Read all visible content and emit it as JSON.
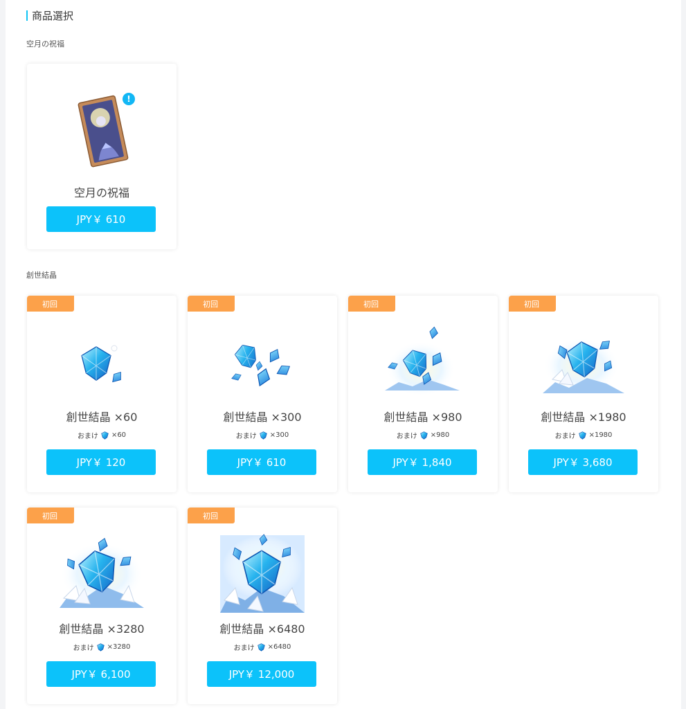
{
  "header": {
    "title": "商品選択"
  },
  "sections": [
    {
      "label": "空月の祝福",
      "items": [
        {
          "name": "空月の祝福",
          "price": "JPY￥ 610",
          "info_icon": "!"
        }
      ]
    },
    {
      "label": "創世結晶",
      "items": [
        {
          "badge": "初回",
          "name": "創世結晶 ×60",
          "bonus_label": "おまけ",
          "bonus_amount": "×60",
          "price": "JPY￥ 120"
        },
        {
          "badge": "初回",
          "name": "創世結晶 ×300",
          "bonus_label": "おまけ",
          "bonus_amount": "×300",
          "price": "JPY￥ 610"
        },
        {
          "badge": "初回",
          "name": "創世結晶 ×980",
          "bonus_label": "おまけ",
          "bonus_amount": "×980",
          "price": "JPY￥ 1,840"
        },
        {
          "badge": "初回",
          "name": "創世結晶 ×1980",
          "bonus_label": "おまけ",
          "bonus_amount": "×1980",
          "price": "JPY￥ 3,680"
        },
        {
          "badge": "初回",
          "name": "創世結晶 ×3280",
          "bonus_label": "おまけ",
          "bonus_amount": "×3280",
          "price": "JPY￥ 6,100"
        },
        {
          "badge": "初回",
          "name": "創世結晶 ×6480",
          "bonus_label": "おまけ",
          "bonus_amount": "×6480",
          "price": "JPY￥ 12,000"
        }
      ]
    }
  ],
  "colors": {
    "accent": "#0cc2fa",
    "badge": "#fca14a",
    "crystal": "#1e9be8"
  },
  "icons": {
    "blessing_art": "welkin-card-art",
    "crystal_art": "genesis-crystal-art",
    "bonus_icon": "genesis-crystal-icon",
    "info": "info-icon"
  }
}
